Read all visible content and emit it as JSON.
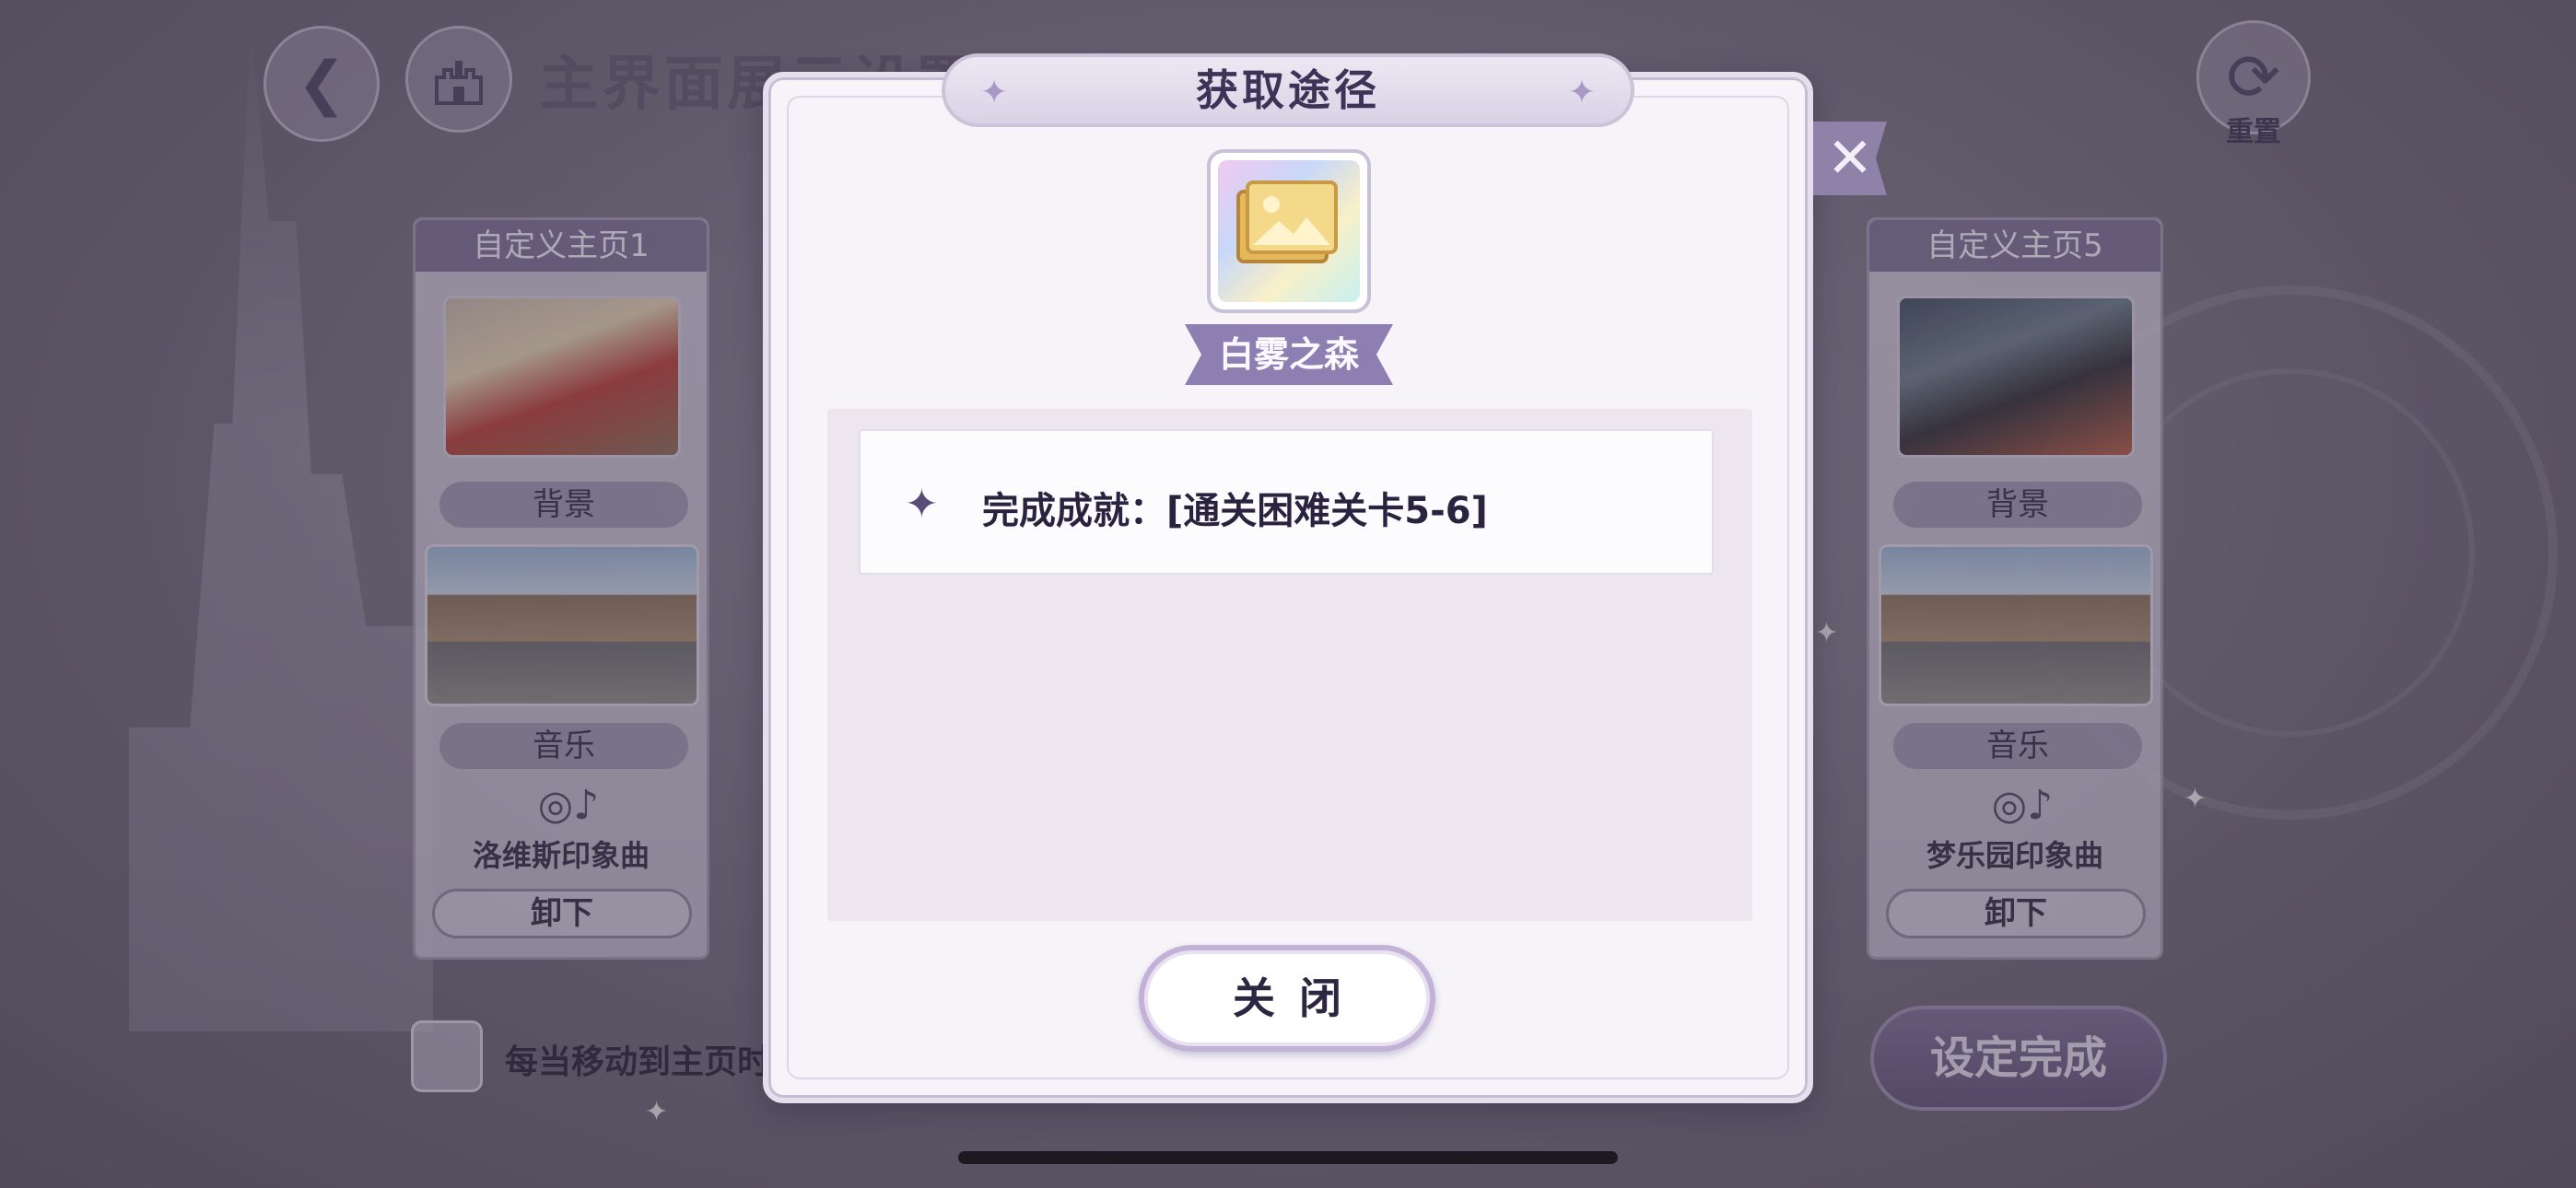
{
  "header": {
    "page_title": "主界面展示设置",
    "back_icon": "back-arrow-icon",
    "home_icon": "castle-icon",
    "reset_label": "重置"
  },
  "left_card": {
    "title": "自定义主页1",
    "background_label": "背景",
    "music_label": "音乐",
    "song_name": "洛维斯印象曲",
    "unload_label": "卸下"
  },
  "right_card": {
    "title": "自定义主页5",
    "background_label": "背景",
    "music_label": "音乐",
    "song_name": "梦乐园印象曲",
    "unload_label": "卸下"
  },
  "footer": {
    "checkbox_label": "每当移动到主页时",
    "done_label": "设定完成"
  },
  "modal": {
    "title": "获取途径",
    "item_name": "白雾之森",
    "sources": [
      {
        "text": "完成成就：[通关困难关卡5-6]"
      }
    ],
    "close_label": "关闭"
  },
  "colors": {
    "accent": "#8e7fb2",
    "modal_bg": "#f6f4f8",
    "panel_bg": "#ede6ee"
  }
}
